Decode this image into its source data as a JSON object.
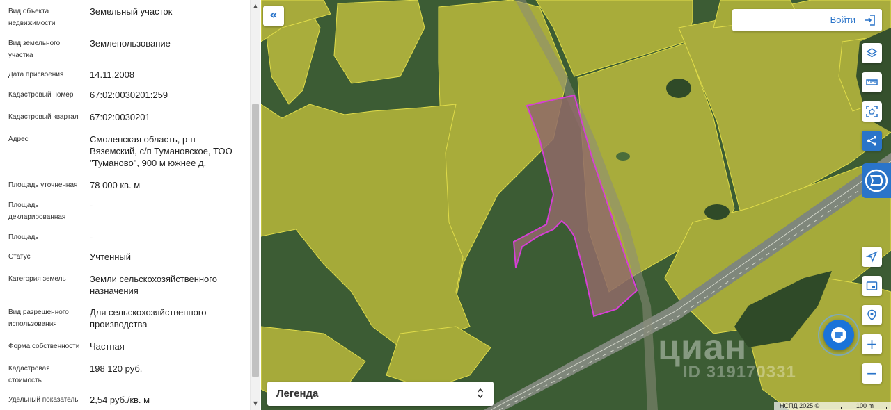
{
  "properties": [
    {
      "label": "Вид объекта недвижимости",
      "value": "Земельный участок"
    },
    {
      "label": "Вид земельного участка",
      "value": "Землепользование"
    },
    {
      "label": "Дата присвоения",
      "value": "14.11.2008"
    },
    {
      "label": "Кадастровый номер",
      "value": "67:02:0030201:259"
    },
    {
      "label": "Кадастровый квартал",
      "value": "67:02:0030201"
    },
    {
      "label": "Адрес",
      "value": "Смоленская область, р-н Вяземский, с/п Тумановское, ТОО \"Туманово\", 900 м южнее д."
    },
    {
      "label": "Площадь уточненная",
      "value": "78 000 кв. м"
    },
    {
      "label": "Площадь декларированная",
      "value": "-"
    },
    {
      "label": "Площадь",
      "value": "-"
    },
    {
      "label": "Статус",
      "value": "Учтенный"
    },
    {
      "label": "Категория земель",
      "value": "Земли сельскохозяйственного назначения"
    },
    {
      "label": "Вид разрешенного использования",
      "value": "Для сельскохозяйственного производства"
    },
    {
      "label": "Форма собственности",
      "value": "Частная"
    },
    {
      "label": "Кадастровая стоимость",
      "value": "198 120 руб."
    },
    {
      "label": "Удельный показатель",
      "value": "2,54 руб./кв. м"
    }
  ],
  "map": {
    "collapse_icon": "«",
    "login_label": "Войти",
    "legend_label": "Легенда",
    "attribution": "НСПД 2025 ©",
    "scale_label": "100 m",
    "watermark_brand": "циан",
    "watermark_id": "ID 319170331",
    "zoom_in": "+",
    "zoom_out": "−",
    "tools": [
      "layers-icon",
      "ruler-icon",
      "select-area-icon",
      "share-icon",
      "gosuslugi-icon",
      "locate-icon",
      "picture-in-picture-icon",
      "geolocation-icon",
      "chat-icon"
    ]
  },
  "colors": {
    "accent": "#2a74c9",
    "selected_parcel": "#d63fd6",
    "parcel_boundary": "#e6e04a"
  }
}
